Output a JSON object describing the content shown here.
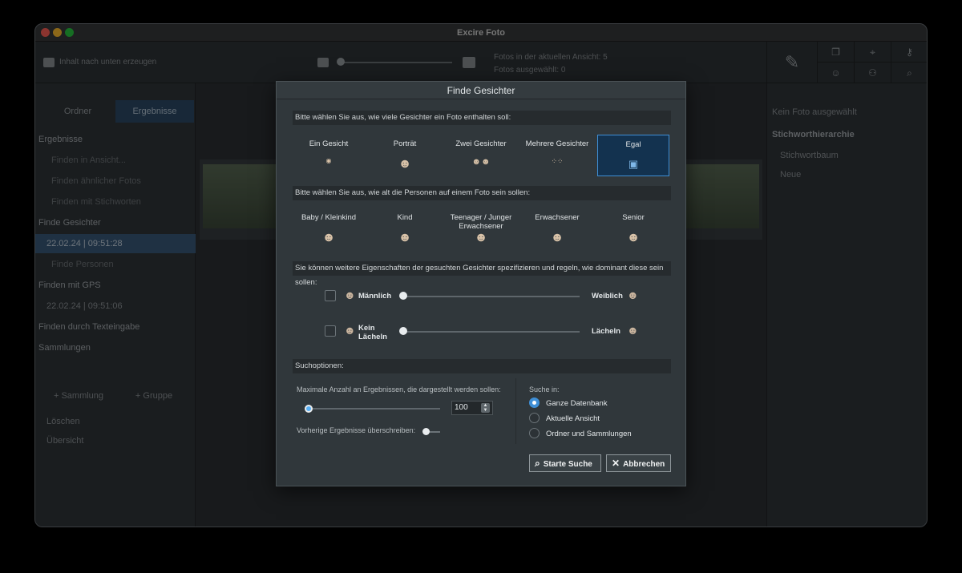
{
  "window": {
    "title": "Excire Foto"
  },
  "background": {
    "toolbar_left_text": "Inhalt nach unten erzeugen",
    "toolbar_info_1": "Fotos in der aktuellen Ansicht: 5",
    "toolbar_info_2": "Fotos ausgewählt: 0",
    "sidebar_tabs": [
      "Ordner",
      "Ergebnisse"
    ],
    "sidebar_rows": [
      {
        "text": "Ergebnisse",
        "style": "head"
      },
      {
        "text": "Finden in Ansicht...",
        "style": "dim"
      },
      {
        "text": "Finden ähnlicher Fotos",
        "style": "dim"
      },
      {
        "text": "Finden mit Stichworten",
        "style": "dim"
      },
      {
        "text": "Finde Gesichter",
        "style": "head"
      },
      {
        "text": "22.02.24 | 09:51:28",
        "style": "sel"
      },
      {
        "text": "Finde Personen",
        "style": "dim"
      },
      {
        "text": "Finden mit GPS",
        "style": "head"
      },
      {
        "text": "22.02.24 | 09:51:06",
        "style": "row"
      },
      {
        "text": "Finden durch Texteingabe",
        "style": "head"
      },
      {
        "text": "Sammlungen",
        "style": "head"
      }
    ],
    "sidebar_buttons": [
      "+ Sammlung",
      "+ Gruppe"
    ],
    "sidebar_extra": [
      "Löschen",
      "Übersicht"
    ],
    "right_pane": {
      "search": "Kein Foto ausgewählt",
      "heading": "Stichworthierarchie",
      "items": [
        "Stichwortbaum",
        "Neue"
      ]
    }
  },
  "dialog": {
    "title": "Finde Gesichter",
    "section_count": "Bitte wählen Sie aus, wie viele Gesichter ein Foto enthalten soll:",
    "count_options": [
      {
        "label": "Ein Gesicht",
        "icon": "single-small-face-icon"
      },
      {
        "label": "Porträt",
        "icon": "portrait-face-icon"
      },
      {
        "label": "Zwei Gesichter",
        "icon": "two-faces-icon"
      },
      {
        "label": "Mehrere Gesichter",
        "icon": "many-faces-icon"
      },
      {
        "label": "Egal",
        "icon": "any-faces-icon"
      }
    ],
    "count_selected": "Egal",
    "section_age": "Bitte wählen Sie aus, wie alt die Personen auf einem Foto sein sollen:",
    "age_options": [
      {
        "label": "Baby / Kleinkind",
        "icon": "baby-face-icon"
      },
      {
        "label": "Kind",
        "icon": "child-face-icon"
      },
      {
        "label": "Teenager / Junger Erwachsener",
        "icon": "teen-face-icon"
      },
      {
        "label": "Erwachsener",
        "icon": "adult-face-icon"
      },
      {
        "label": "Senior",
        "icon": "senior-face-icon"
      }
    ],
    "section_traits": "Sie können weitere Eigenschaften der gesuchten Gesichter spezifizieren und regeln, wie dominant diese sein sollen:",
    "traits": [
      {
        "left": "Männlich",
        "right": "Weiblich",
        "checked": false,
        "value": 0
      },
      {
        "left": "Kein Lächeln",
        "right": "Lächeln",
        "checked": false,
        "value": 0
      }
    ],
    "section_search": "Suchoptionen:",
    "max_results_label": "Maximale Anzahl an Ergebnissen, die dargestellt werden sollen:",
    "max_results_value": "100",
    "overwrite_label": "Vorherige Ergebnisse überschreiben:",
    "search_in_label": "Suche in:",
    "search_in_options": [
      "Ganze Datenbank",
      "Aktuelle Ansicht",
      "Ordner und Sammlungen"
    ],
    "search_in_selected": "Ganze Datenbank",
    "start_button": "Starte Suche",
    "cancel_button": "Abbrechen",
    "accent_color": "#3f8fd6"
  }
}
